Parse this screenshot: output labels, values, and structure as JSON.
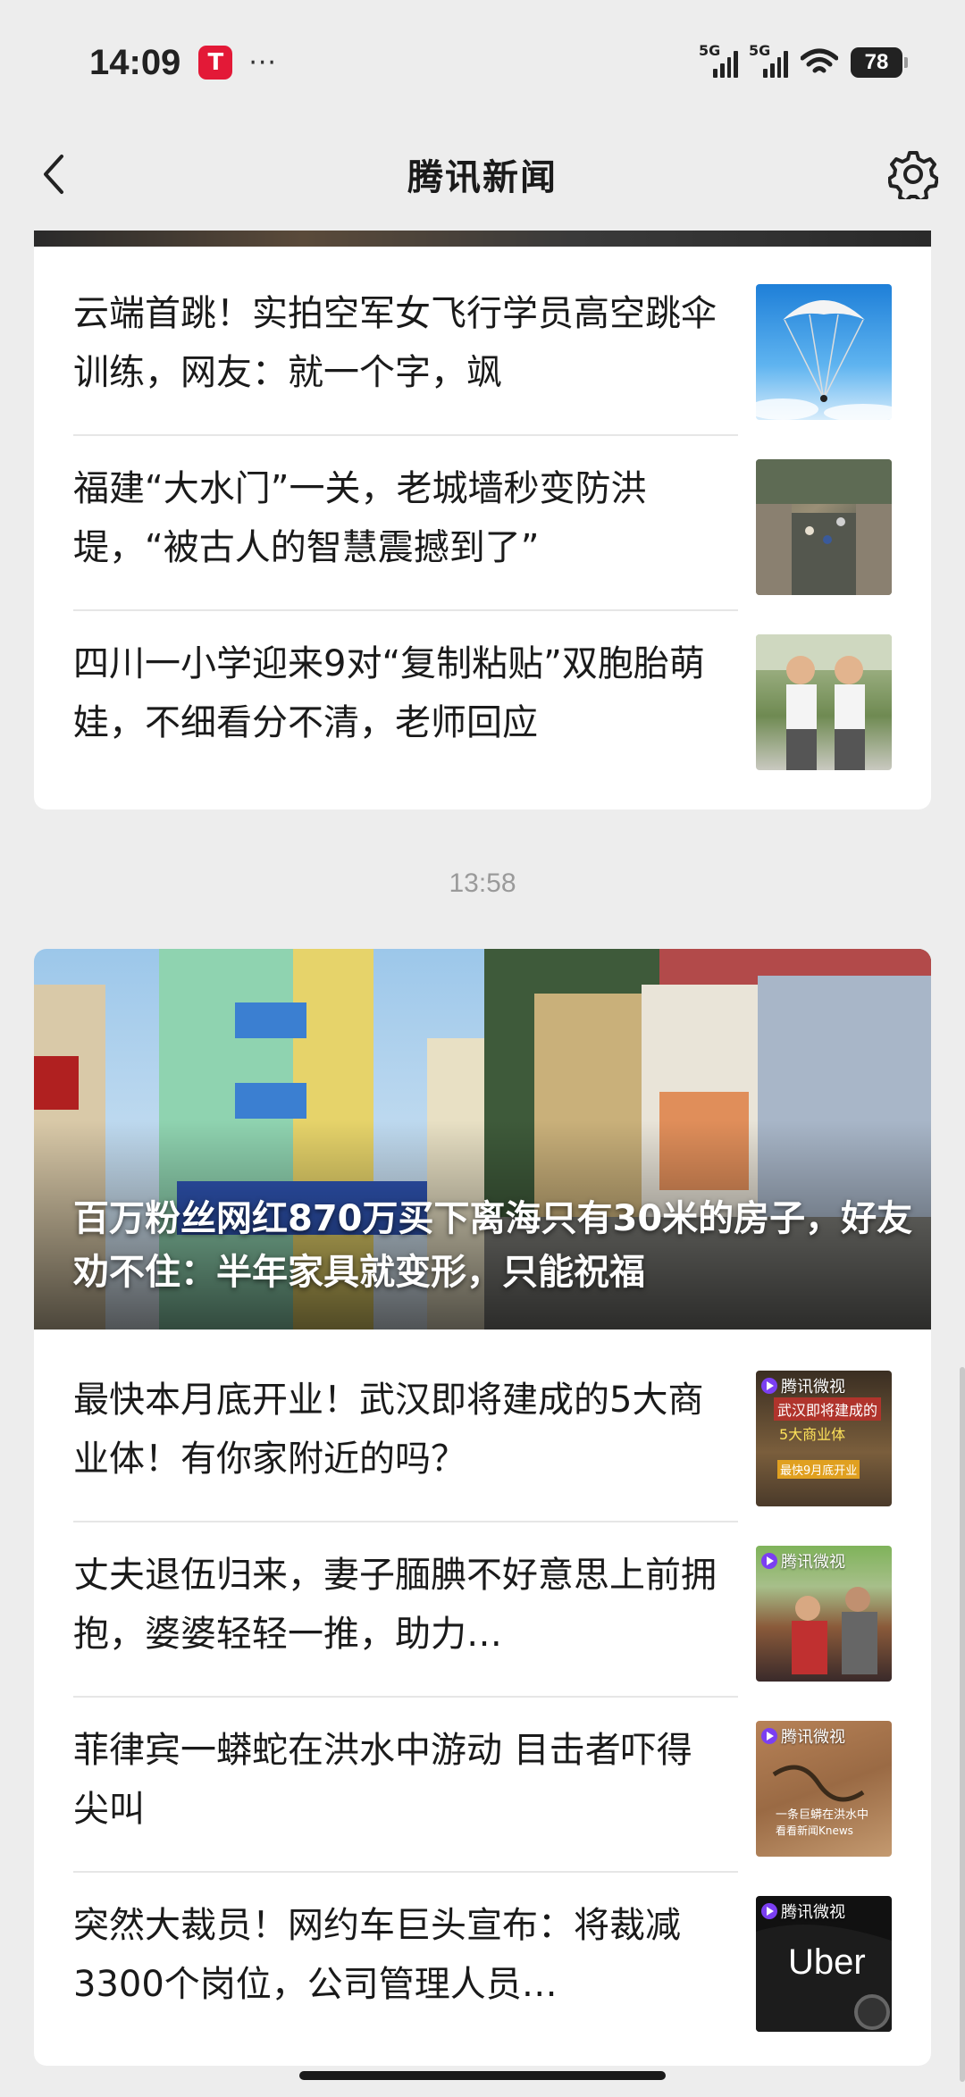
{
  "status_bar": {
    "time": "14:09",
    "app_icon": "tesla-icon",
    "more": "···",
    "signal1_label": "5G",
    "signal2_label": "5G",
    "battery": "78"
  },
  "header": {
    "title": "腾讯新闻",
    "back_icon": "chevron-left-icon",
    "settings_icon": "gear-icon"
  },
  "group1": {
    "items": [
      {
        "title": "云端首跳！实拍空军女飞行学员高空跳伞训练，网友：就一个字，飒"
      },
      {
        "title": "福建“大水门”一关，老城墙秒变防洪堤，“被古人的智慧震撼到了”"
      },
      {
        "title": "四川一小学迎来9对“复制粘贴”双胞胎萌娃，不细看分不清，老师回应"
      }
    ]
  },
  "timestamp": "13:58",
  "group2": {
    "hero_title": "百万粉丝网红870万买下离海只有30米的房子，好友劝不住：半年家具就变形，只能祝福",
    "items": [
      {
        "title": "最快本月底开业！武汉即将建成的5大商业体！有你家附近的吗？",
        "badge": "腾讯微视",
        "thumb_text": "武汉即将建成的",
        "thumb_text2": "5大商业体",
        "thumb_text3": "最快9月底开业"
      },
      {
        "title": "丈夫退伍归来，妻子腼腆不好意思上前拥抱，婆婆轻轻一推，助力…",
        "badge": "腾讯微视"
      },
      {
        "title": "菲律宾一蟒蛇在洪水中游动 目击者吓得尖叫",
        "badge": "腾讯微视",
        "thumb_text": "一条巨蟒在洪水中",
        "thumb_text2": "看看新闻Knews"
      },
      {
        "title": "突然大裁员！网约车巨头宣布：将裁减3300个岗位，公司管理人员…",
        "badge": "腾讯微视",
        "thumb_text": "Uber"
      }
    ]
  }
}
